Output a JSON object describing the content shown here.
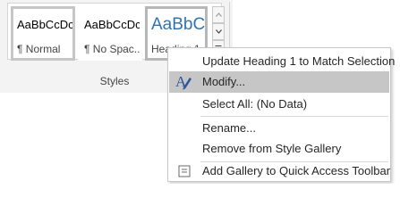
{
  "ribbon": {
    "group_caption": "Styles",
    "styles": [
      {
        "sample": "AaBbCcDc",
        "name": "¶ Normal"
      },
      {
        "sample": "AaBbCcDc",
        "name": "¶ No Spac..."
      },
      {
        "sample": "AaBbCc",
        "name": "Heading 1"
      }
    ],
    "scroll_up_icon": "chevron-up-icon",
    "scroll_down_icon": "chevron-down-icon",
    "more_icon": "more-dropdown-icon",
    "launcher_icon": "dialog-launcher-icon",
    "heading_color": "#2e74b5"
  },
  "context_menu": {
    "items": [
      {
        "label": "Update Heading 1 to Match Selection"
      },
      {
        "label": "Modify...",
        "icon": "style-modify-icon",
        "highlighted": true
      },
      {
        "label": "Select All: (No Data)"
      },
      {
        "label": "Rename..."
      },
      {
        "label": "Remove from Style Gallery"
      },
      {
        "label": "Add Gallery to Quick Access Toolbar",
        "icon": "quick-access-toolbar-icon"
      }
    ],
    "highlight_color": "#c6c6c6"
  }
}
